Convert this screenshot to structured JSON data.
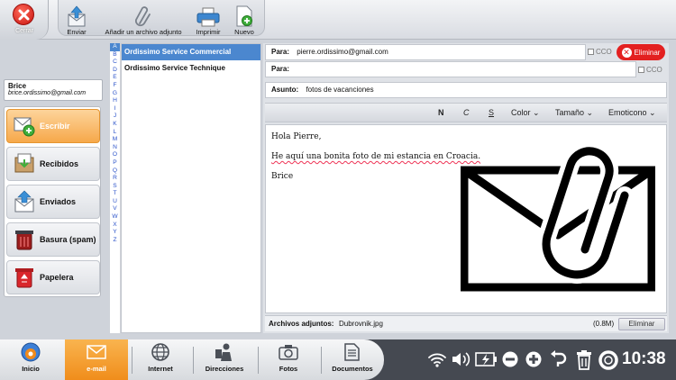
{
  "toolbar": {
    "close_label": "Cerrar",
    "buttons": [
      {
        "label": "Enviar",
        "icon": "send-icon"
      },
      {
        "label": "Añadir un archivo adjunto",
        "icon": "paperclip-icon"
      },
      {
        "label": "Imprimir",
        "icon": "printer-icon"
      },
      {
        "label": "Nuevo",
        "icon": "new-document-icon"
      }
    ]
  },
  "user": {
    "name": "Brice",
    "email": "brice.ordissimo@gmail.com"
  },
  "nav": {
    "items": [
      {
        "label": "Escribir",
        "icon": "compose-icon",
        "active": true
      },
      {
        "label": "Recibidos",
        "icon": "inbox-icon",
        "active": false
      },
      {
        "label": "Enviados",
        "icon": "sent-icon",
        "active": false
      },
      {
        "label": "Basura (spam)",
        "icon": "spam-icon",
        "active": false
      },
      {
        "label": "Papelera",
        "icon": "trash-icon",
        "active": false
      }
    ]
  },
  "alphabet": [
    "A",
    "B",
    "C",
    "D",
    "E",
    "F",
    "G",
    "H",
    "I",
    "J",
    "K",
    "L",
    "M",
    "N",
    "O",
    "P",
    "Q",
    "R",
    "S",
    "T",
    "U",
    "V",
    "W",
    "X",
    "Y",
    "Z"
  ],
  "contacts": [
    {
      "name": "Ordissimo Service Commercial",
      "selected": true
    },
    {
      "name": "Ordissimo Service Technique",
      "selected": false
    }
  ],
  "compose": {
    "to_label": "Para:",
    "to_value": "pierre.ordissimo@gmail.com",
    "to2_label": "Para:",
    "to2_value": "",
    "cco_label": "CCO",
    "remove_label": "Eliminar",
    "subject_label": "Asunto:",
    "subject_value": "fotos de vacanciones",
    "format": {
      "bold": "N",
      "italic": "C",
      "underline": "S",
      "color": "Color",
      "size": "Tamaño",
      "emoticon": "Emoticono"
    },
    "body": [
      "Hola Pierre,",
      "He aquí una bonita foto de mi estancia en Croacia.",
      "Brice"
    ],
    "attachments_label": "Archivos adjuntos:",
    "attachment_name": "Dubrovnik.jpg",
    "attachment_size": "(0.8M)",
    "attachment_remove": "Eliminar"
  },
  "dock": {
    "items": [
      {
        "label": "Inicio",
        "icon": "home-icon"
      },
      {
        "label": "e-mail",
        "icon": "email-icon",
        "active": true
      },
      {
        "label": "Internet",
        "icon": "globe-icon"
      },
      {
        "label": "Direcciones",
        "icon": "contacts-icon"
      },
      {
        "label": "Fotos",
        "icon": "camera-icon"
      },
      {
        "label": "Documentos",
        "icon": "folder-icon"
      }
    ]
  },
  "clock": "10:38",
  "colors": {
    "accent_orange": "#f39a2c",
    "selection_blue": "#4b87cf",
    "danger_red": "#e32020",
    "taskbar": "#454951"
  }
}
